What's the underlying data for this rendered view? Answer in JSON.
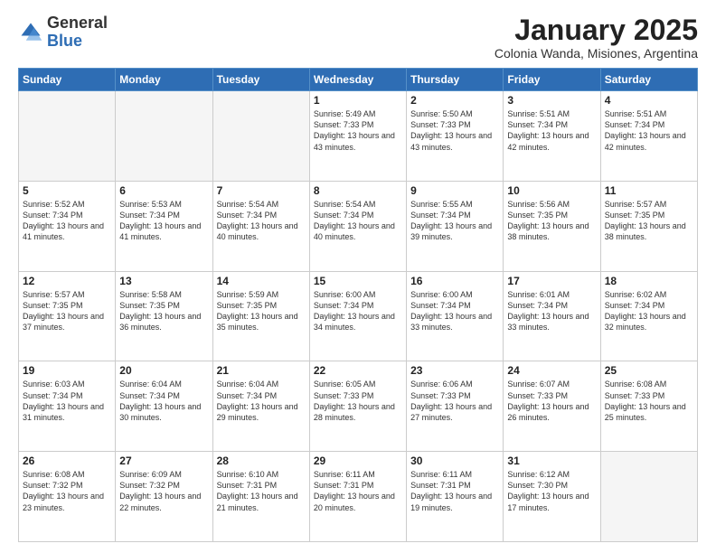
{
  "header": {
    "logo_general": "General",
    "logo_blue": "Blue",
    "month_title": "January 2025",
    "location": "Colonia Wanda, Misiones, Argentina"
  },
  "days_of_week": [
    "Sunday",
    "Monday",
    "Tuesday",
    "Wednesday",
    "Thursday",
    "Friday",
    "Saturday"
  ],
  "weeks": [
    [
      {
        "day": "",
        "text": ""
      },
      {
        "day": "",
        "text": ""
      },
      {
        "day": "",
        "text": ""
      },
      {
        "day": "1",
        "text": "Sunrise: 5:49 AM\nSunset: 7:33 PM\nDaylight: 13 hours\nand 43 minutes."
      },
      {
        "day": "2",
        "text": "Sunrise: 5:50 AM\nSunset: 7:33 PM\nDaylight: 13 hours\nand 43 minutes."
      },
      {
        "day": "3",
        "text": "Sunrise: 5:51 AM\nSunset: 7:34 PM\nDaylight: 13 hours\nand 42 minutes."
      },
      {
        "day": "4",
        "text": "Sunrise: 5:51 AM\nSunset: 7:34 PM\nDaylight: 13 hours\nand 42 minutes."
      }
    ],
    [
      {
        "day": "5",
        "text": "Sunrise: 5:52 AM\nSunset: 7:34 PM\nDaylight: 13 hours\nand 41 minutes."
      },
      {
        "day": "6",
        "text": "Sunrise: 5:53 AM\nSunset: 7:34 PM\nDaylight: 13 hours\nand 41 minutes."
      },
      {
        "day": "7",
        "text": "Sunrise: 5:54 AM\nSunset: 7:34 PM\nDaylight: 13 hours\nand 40 minutes."
      },
      {
        "day": "8",
        "text": "Sunrise: 5:54 AM\nSunset: 7:34 PM\nDaylight: 13 hours\nand 40 minutes."
      },
      {
        "day": "9",
        "text": "Sunrise: 5:55 AM\nSunset: 7:34 PM\nDaylight: 13 hours\nand 39 minutes."
      },
      {
        "day": "10",
        "text": "Sunrise: 5:56 AM\nSunset: 7:35 PM\nDaylight: 13 hours\nand 38 minutes."
      },
      {
        "day": "11",
        "text": "Sunrise: 5:57 AM\nSunset: 7:35 PM\nDaylight: 13 hours\nand 38 minutes."
      }
    ],
    [
      {
        "day": "12",
        "text": "Sunrise: 5:57 AM\nSunset: 7:35 PM\nDaylight: 13 hours\nand 37 minutes."
      },
      {
        "day": "13",
        "text": "Sunrise: 5:58 AM\nSunset: 7:35 PM\nDaylight: 13 hours\nand 36 minutes."
      },
      {
        "day": "14",
        "text": "Sunrise: 5:59 AM\nSunset: 7:35 PM\nDaylight: 13 hours\nand 35 minutes."
      },
      {
        "day": "15",
        "text": "Sunrise: 6:00 AM\nSunset: 7:34 PM\nDaylight: 13 hours\nand 34 minutes."
      },
      {
        "day": "16",
        "text": "Sunrise: 6:00 AM\nSunset: 7:34 PM\nDaylight: 13 hours\nand 33 minutes."
      },
      {
        "day": "17",
        "text": "Sunrise: 6:01 AM\nSunset: 7:34 PM\nDaylight: 13 hours\nand 33 minutes."
      },
      {
        "day": "18",
        "text": "Sunrise: 6:02 AM\nSunset: 7:34 PM\nDaylight: 13 hours\nand 32 minutes."
      }
    ],
    [
      {
        "day": "19",
        "text": "Sunrise: 6:03 AM\nSunset: 7:34 PM\nDaylight: 13 hours\nand 31 minutes."
      },
      {
        "day": "20",
        "text": "Sunrise: 6:04 AM\nSunset: 7:34 PM\nDaylight: 13 hours\nand 30 minutes."
      },
      {
        "day": "21",
        "text": "Sunrise: 6:04 AM\nSunset: 7:34 PM\nDaylight: 13 hours\nand 29 minutes."
      },
      {
        "day": "22",
        "text": "Sunrise: 6:05 AM\nSunset: 7:33 PM\nDaylight: 13 hours\nand 28 minutes."
      },
      {
        "day": "23",
        "text": "Sunrise: 6:06 AM\nSunset: 7:33 PM\nDaylight: 13 hours\nand 27 minutes."
      },
      {
        "day": "24",
        "text": "Sunrise: 6:07 AM\nSunset: 7:33 PM\nDaylight: 13 hours\nand 26 minutes."
      },
      {
        "day": "25",
        "text": "Sunrise: 6:08 AM\nSunset: 7:33 PM\nDaylight: 13 hours\nand 25 minutes."
      }
    ],
    [
      {
        "day": "26",
        "text": "Sunrise: 6:08 AM\nSunset: 7:32 PM\nDaylight: 13 hours\nand 23 minutes."
      },
      {
        "day": "27",
        "text": "Sunrise: 6:09 AM\nSunset: 7:32 PM\nDaylight: 13 hours\nand 22 minutes."
      },
      {
        "day": "28",
        "text": "Sunrise: 6:10 AM\nSunset: 7:31 PM\nDaylight: 13 hours\nand 21 minutes."
      },
      {
        "day": "29",
        "text": "Sunrise: 6:11 AM\nSunset: 7:31 PM\nDaylight: 13 hours\nand 20 minutes."
      },
      {
        "day": "30",
        "text": "Sunrise: 6:11 AM\nSunset: 7:31 PM\nDaylight: 13 hours\nand 19 minutes."
      },
      {
        "day": "31",
        "text": "Sunrise: 6:12 AM\nSunset: 7:30 PM\nDaylight: 13 hours\nand 17 minutes."
      },
      {
        "day": "",
        "text": ""
      }
    ]
  ]
}
